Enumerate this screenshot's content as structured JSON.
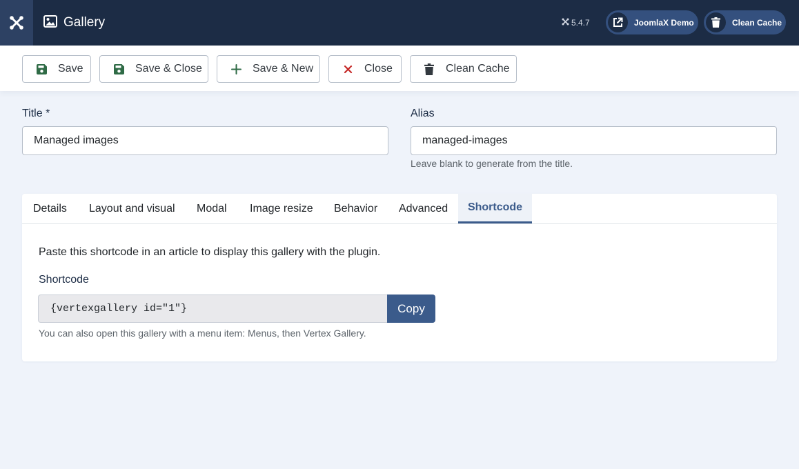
{
  "header": {
    "title": "Gallery",
    "version": "5.4.7",
    "demo_label": "JoomlaX Demo",
    "clean_cache_label": "Clean Cache"
  },
  "toolbar": {
    "save": "Save",
    "save_close": "Save & Close",
    "save_new": "Save & New",
    "close": "Close",
    "clean_cache": "Clean Cache"
  },
  "form": {
    "title_label": "Title *",
    "title_value": "Managed images",
    "alias_label": "Alias",
    "alias_value": "managed-images",
    "alias_hint": "Leave blank to generate from the title."
  },
  "tabs": [
    "Details",
    "Layout and visual",
    "Modal",
    "Image resize",
    "Behavior",
    "Advanced",
    "Shortcode"
  ],
  "active_tab": "Shortcode",
  "shortcode_panel": {
    "intro": "Paste this shortcode in an article to display this gallery with the plugin.",
    "label": "Shortcode",
    "value": "{vertexgallery id=\"1\"}",
    "copy_label": "Copy",
    "hint": "You can also open this gallery with a menu item: Menus, then Vertex Gallery."
  },
  "colors": {
    "header_bg": "#1c2c45",
    "accent": "#3b5b8b",
    "save_icon": "#2f6b46",
    "close_icon": "#c52827",
    "page_bg": "#eff3fa"
  },
  "icons": {
    "logo": "joomla-logo-icon",
    "title": "image-icon",
    "demo": "external-link-icon",
    "cache": "trash-icon",
    "save": "floppy-disk-icon",
    "save_new": "plus-icon",
    "close": "x-icon"
  }
}
